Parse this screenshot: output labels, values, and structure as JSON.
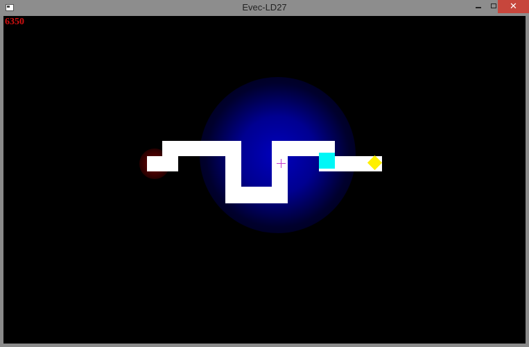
{
  "window": {
    "title": "Evec-LD27",
    "minimize_glyph": "",
    "maximize_glyph": "",
    "close_glyph": "✕"
  },
  "hud": {
    "score": "6350"
  },
  "colors": {
    "background": "#000000",
    "path": "#ffffff",
    "player": "#00f7f7",
    "goal": "#fff000",
    "crosshair": "#c33ccf",
    "score": "#d01010",
    "blue_glow": "#0000be",
    "red_glow": "#780000"
  },
  "entities": {
    "player": "cyan-square",
    "goal": "yellow-diamond",
    "cursor": "crosshair-icon",
    "hazard_glow": "red-glow",
    "light_glow": "blue-glow"
  }
}
